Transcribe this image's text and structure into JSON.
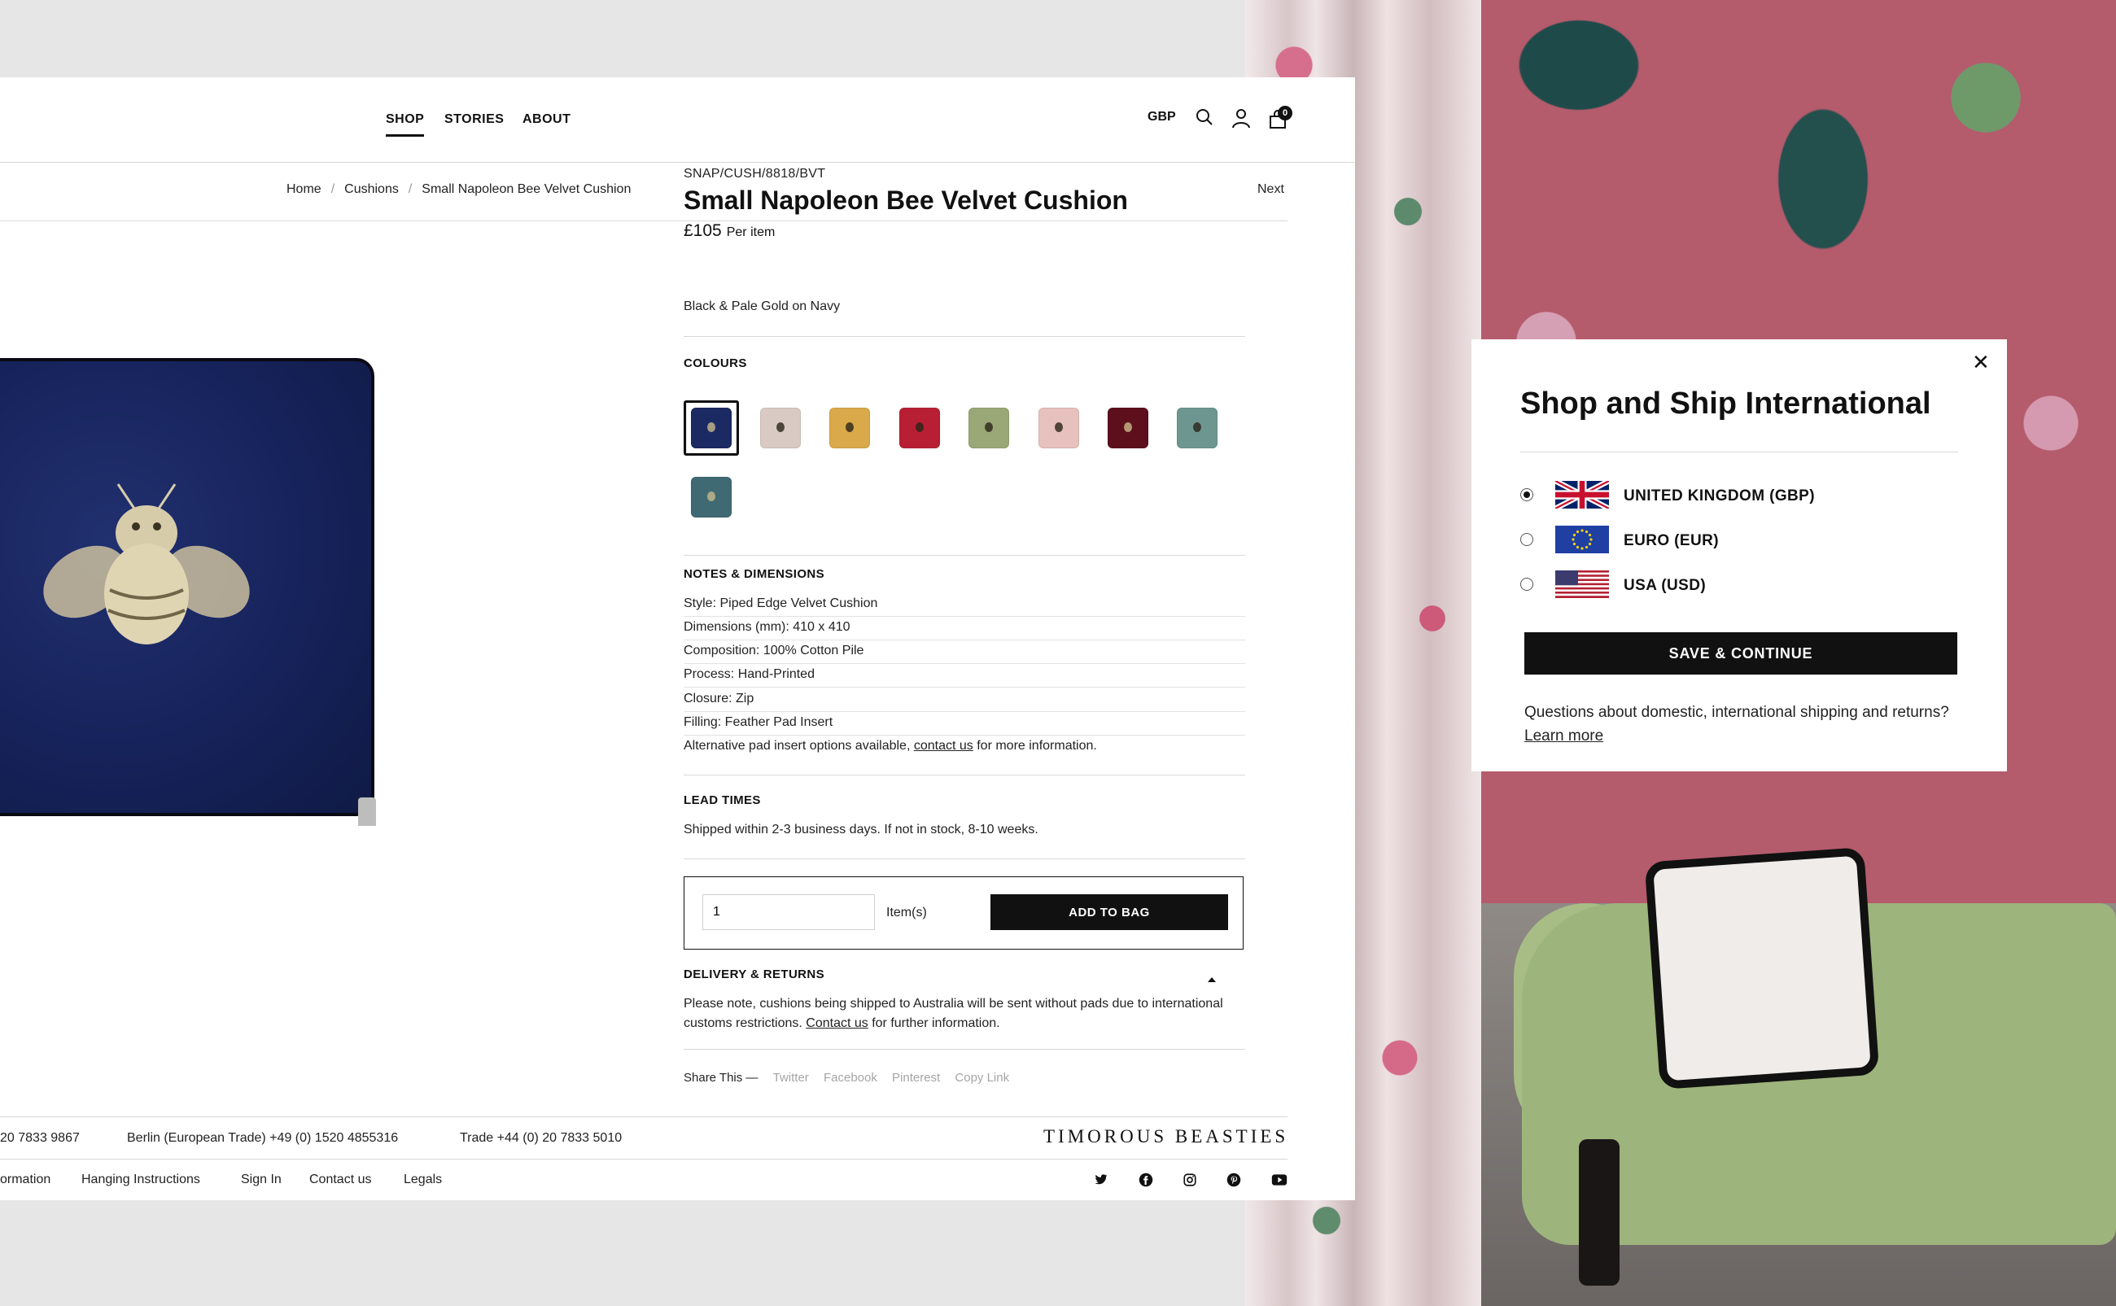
{
  "nav": {
    "shop": "SHOP",
    "stories": "STORIES",
    "about": "ABOUT",
    "currency": "GBP",
    "cart_count": "0"
  },
  "breadcrumb": {
    "home": "Home",
    "cushions": "Cushions",
    "current": "Small Napoleon Bee Velvet Cushion",
    "next": "Next"
  },
  "product": {
    "sku": "SNAP/CUSH/8818/BVT",
    "title": "Small Napoleon Bee Velvet Cushion",
    "price": "£105",
    "price_unit": "Per item",
    "colours_heading": "COLOURS",
    "selected_colour": "Black & Pale Gold on Navy",
    "swatches": [
      {
        "color": "#1c2a63",
        "selected": true
      },
      {
        "color": "#d9cbc4"
      },
      {
        "color": "#d9a94a"
      },
      {
        "color": "#b81f34"
      },
      {
        "color": "#9aa878"
      },
      {
        "color": "#e7c1bd"
      },
      {
        "color": "#5e0f1c"
      },
      {
        "color": "#6e9690"
      },
      {
        "color": "#3f6a73"
      }
    ],
    "notes_heading": "NOTES & DIMENSIONS",
    "notes": {
      "style": "Style: Piped Edge Velvet Cushion",
      "dimensions": "Dimensions (mm): 410 x 410",
      "composition": "Composition: 100% Cotton Pile",
      "process": "Process: Hand-Printed",
      "closure": "Closure: Zip",
      "filling": "Filling: Feather Pad Insert",
      "alt_prefix": "Alternative pad insert options available, ",
      "alt_link": "contact us",
      "alt_suffix": " for more information."
    },
    "lead_heading": "LEAD TIMES",
    "lead_text": "Shipped within 2-3 business days. If not in stock, 8-10 weeks.",
    "quantity": "1",
    "items_label": "Item(s)",
    "add_to_bag": "ADD TO BAG",
    "delivery_heading": "DELIVERY & RETURNS",
    "delivery_prefix": "Please note, cushions being shipped to Australia will be sent without pads due to international customs restrictions. ",
    "delivery_link": "Contact us",
    "delivery_suffix": " for further information.",
    "share_label": "Share This —",
    "share_links": {
      "twitter": "Twitter",
      "facebook": "Facebook",
      "pinterest": "Pinterest",
      "copy": "Copy Link"
    }
  },
  "footer": {
    "phone_partial": "20 7833 9867",
    "berlin": "Berlin (European Trade) +49 (0) 1520 4855316",
    "trade": "Trade +44 (0) 20 7833 5010",
    "brand": "TIMOROUS BEASTIES",
    "links": {
      "information_partial": "ormation",
      "hanging": "Hanging Instructions",
      "signin": "Sign In",
      "contact": "Contact us",
      "legals": "Legals"
    },
    "social_icons": [
      "twitter-icon",
      "facebook-icon",
      "instagram-icon",
      "pinterest-icon",
      "youtube-icon"
    ]
  },
  "modal": {
    "title": "Shop and Ship International",
    "options": [
      {
        "label": "UNITED KINGDOM (GBP)",
        "selected": true
      },
      {
        "label": "EURO (EUR)",
        "selected": false
      },
      {
        "label": "USA (USD)",
        "selected": false
      }
    ],
    "save": "SAVE & CONTINUE",
    "note_prefix": "Questions about domestic, international shipping and returns? ",
    "note_link": "Learn more"
  }
}
